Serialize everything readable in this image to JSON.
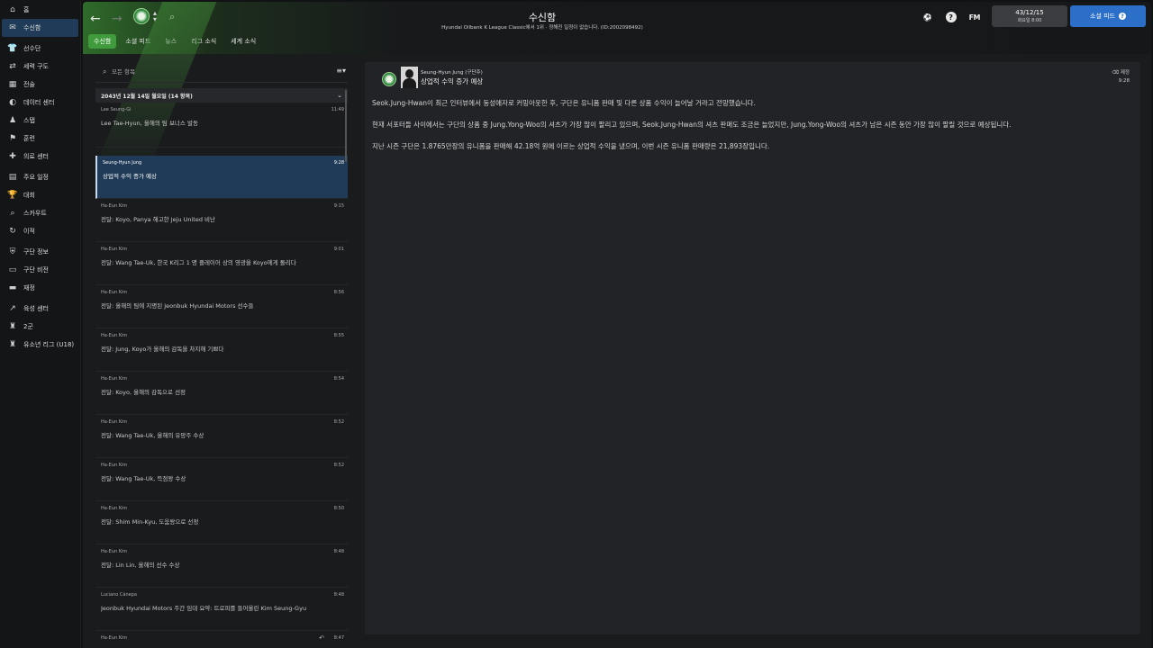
{
  "sidebar": {
    "items": [
      {
        "label": "홈",
        "icon": "home-icon",
        "glyph": "⌂",
        "active": false
      },
      {
        "label": "수신함",
        "icon": "inbox-icon",
        "glyph": "✉",
        "active": true
      },
      {
        "label": "선수단",
        "icon": "shirt-icon",
        "glyph": "👕",
        "active": false
      },
      {
        "label": "세력 구도",
        "icon": "tactics-icon",
        "glyph": "⇄",
        "active": false
      },
      {
        "label": "전술",
        "icon": "clipboard-icon",
        "glyph": "▦",
        "active": false
      },
      {
        "label": "데이터 센터",
        "icon": "data-icon",
        "glyph": "◐",
        "active": false
      },
      {
        "label": "스탭",
        "icon": "staff-icon",
        "glyph": "♟",
        "active": false
      },
      {
        "label": "훈련",
        "icon": "training-icon",
        "glyph": "⚑",
        "active": false
      },
      {
        "label": "의료 센터",
        "icon": "medical-icon",
        "glyph": "✚",
        "active": false
      },
      {
        "label": "주요 일정",
        "icon": "calendar-icon",
        "glyph": "▤",
        "active": false
      },
      {
        "label": "대회",
        "icon": "trophy-icon",
        "glyph": "🏆",
        "active": false
      },
      {
        "label": "스카우트",
        "icon": "scout-icon",
        "glyph": "⌕",
        "active": false
      },
      {
        "label": "이적",
        "icon": "transfer-icon",
        "glyph": "↻",
        "active": false
      },
      {
        "label": "구단 정보",
        "icon": "club-info-icon",
        "glyph": "⛨",
        "active": false
      },
      {
        "label": "구단 비전",
        "icon": "vision-icon",
        "glyph": "▭",
        "active": false
      },
      {
        "label": "재정",
        "icon": "finance-icon",
        "glyph": "▬",
        "active": false
      },
      {
        "label": "육성 센터",
        "icon": "development-icon",
        "glyph": "↗",
        "active": false
      },
      {
        "label": "2군",
        "icon": "reserve-icon",
        "glyph": "♜",
        "active": false
      },
      {
        "label": "유소년 리그 (U18)",
        "icon": "youth-icon",
        "glyph": "♜",
        "active": false
      }
    ]
  },
  "header": {
    "title": "수신함",
    "subtitle": "Hyundai Oilbank K League Classic에서 1위 · 정해진 일정이 없습니다. (ID:2002098492)",
    "tabs": [
      {
        "label": "수신함",
        "active": true
      },
      {
        "label": "소셜 피드",
        "active": false
      },
      {
        "label": "뉴스",
        "active": false
      },
      {
        "label": "리그 소식",
        "active": false
      },
      {
        "label": "세계 소식",
        "active": false
      }
    ],
    "date_main": "43/12/15",
    "date_sub": "화요일 8:00",
    "social_button": "소셜 피드",
    "fm_logo": "FM",
    "help": "?"
  },
  "inbox": {
    "search_placeholder": "모든 항목",
    "group_label": "2043년 12월 14일 월요일 (14 항목)",
    "messages": [
      {
        "sender": "Lee Seung-Gi",
        "time": "11:49",
        "subject": "Lee Tae-Hyun, 올해의 팀 보너스 발동",
        "selected": false
      },
      {
        "sender": "Seung-Hyun Jung",
        "time": "9:28",
        "subject": "상업적 수익 증가 예상",
        "selected": true
      },
      {
        "sender": "Ha-Eun Kim",
        "time": "9:15",
        "subject": "전달: Koyo, Panya 해고한 Jeju United 비난",
        "selected": false
      },
      {
        "sender": "Ha-Eun Kim",
        "time": "9:01",
        "subject": "전달: Wang Tae-Uk, 한국 K리그 1 명 플레이어 상의 영광을 Koyo에게 돌리다",
        "selected": false
      },
      {
        "sender": "Ha-Eun Kim",
        "time": "8:56",
        "subject": "전달: 올해의 팀에 지명된 Jeonbuk Hyundai Motors 선수들",
        "selected": false
      },
      {
        "sender": "Ha-Eun Kim",
        "time": "8:55",
        "subject": "전달: Jung, Koyo가 올해의 감독을 차지해 기쁘다",
        "selected": false
      },
      {
        "sender": "Ha-Eun Kim",
        "time": "8:54",
        "subject": "전달: Koyo, 올해의 감독으로 선정",
        "selected": false
      },
      {
        "sender": "Ha-Eun Kim",
        "time": "8:52",
        "subject": "전달: Wang Tae-Uk, 올해의 유망주 수상",
        "selected": false
      },
      {
        "sender": "Ha-Eun Kim",
        "time": "8:52",
        "subject": "전달: Wang Tae-Uk, 득점왕 수상",
        "selected": false
      },
      {
        "sender": "Ha-Eun Kim",
        "time": "8:50",
        "subject": "전달: Shim Min-Kyu, 도움왕으로 선정",
        "selected": false
      },
      {
        "sender": "Ha-Eun Kim",
        "time": "8:48",
        "subject": "전달: Lin Lin, 올해의 선수 수상",
        "selected": false
      },
      {
        "sender": "Luciano Cánepa",
        "time": "8:48",
        "subject": "Jeonbuk Hyundai Motors 주간 임대 요약: 트로피를 들어올린 Kim Seung-Gyu",
        "selected": false
      },
      {
        "sender": "Ha-Eun Kim",
        "time": "8:47",
        "subject": "",
        "selected": false
      }
    ]
  },
  "detail": {
    "sender": "Seung-Hyun Jung (구단주)",
    "subject": "상업적 수익 증가 예상",
    "delete_label": "제정",
    "time": "9:28",
    "body": [
      "Seok.Jung-Hwan이 최근 인터뷰에서 동성애자로 커밍아웃한 후, 구단은 유니폼 판매 및 다른 상품 수익이 늘어날 거라고 전망했습니다.",
      "현재 서포터들 사이에서는 구단의 상품 중 Jung.Yong-Woo의 셔츠가 가장 많이 팔리고 있으며, Seok.Jung-Hwan의 셔츠 판매도 조금은 늘었지만, Jung.Yong-Woo의 셔츠가 남은 시즌 동안 가장 많이 팔릴 것으로 예상됩니다.",
      "지난 시즌 구단은 1.8765만장의 유니폼을 판매해 42.18억 원에 이르는 상업적 수익을 냈으며, 이번 시즌 유니폼 판매량은 21,893장입니다."
    ]
  }
}
